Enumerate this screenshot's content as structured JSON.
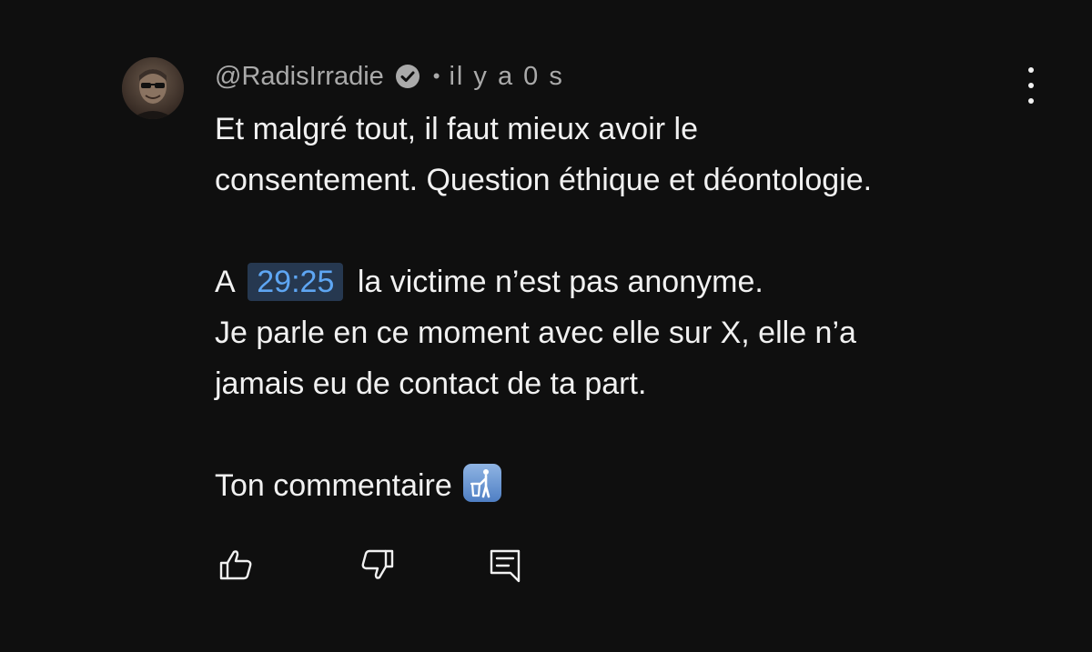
{
  "comment": {
    "author": "@RadisIrradie",
    "separator": "•",
    "time": "il y a 0 s",
    "lines": [
      "Et malgré tout, il faut mieux avoir le",
      "consentement. Question éthique et déontologie."
    ],
    "paragraph2": {
      "prefix": "A",
      "timestamp": "29:25",
      "suffix": "la victime n’est pas anonyme.",
      "line2": "Je parle en ce moment avec elle sur X, elle n’a",
      "line3": "jamais eu de contact de ta part."
    },
    "closing": "Ton commentaire",
    "icons": {
      "verified": "verified-check-icon",
      "emoji": "litter-in-bin-sign-emoji",
      "like": "thumbs-up-icon",
      "dislike": "thumbs-down-icon",
      "reply": "reply-comment-icon",
      "menu": "more-vertical-icon"
    }
  },
  "colors": {
    "background": "#0f0f0f",
    "text": "#f1f1f1",
    "meta": "#aaaaaa",
    "timestamp_text": "#5ea6f3",
    "timestamp_bg": "#263850"
  }
}
